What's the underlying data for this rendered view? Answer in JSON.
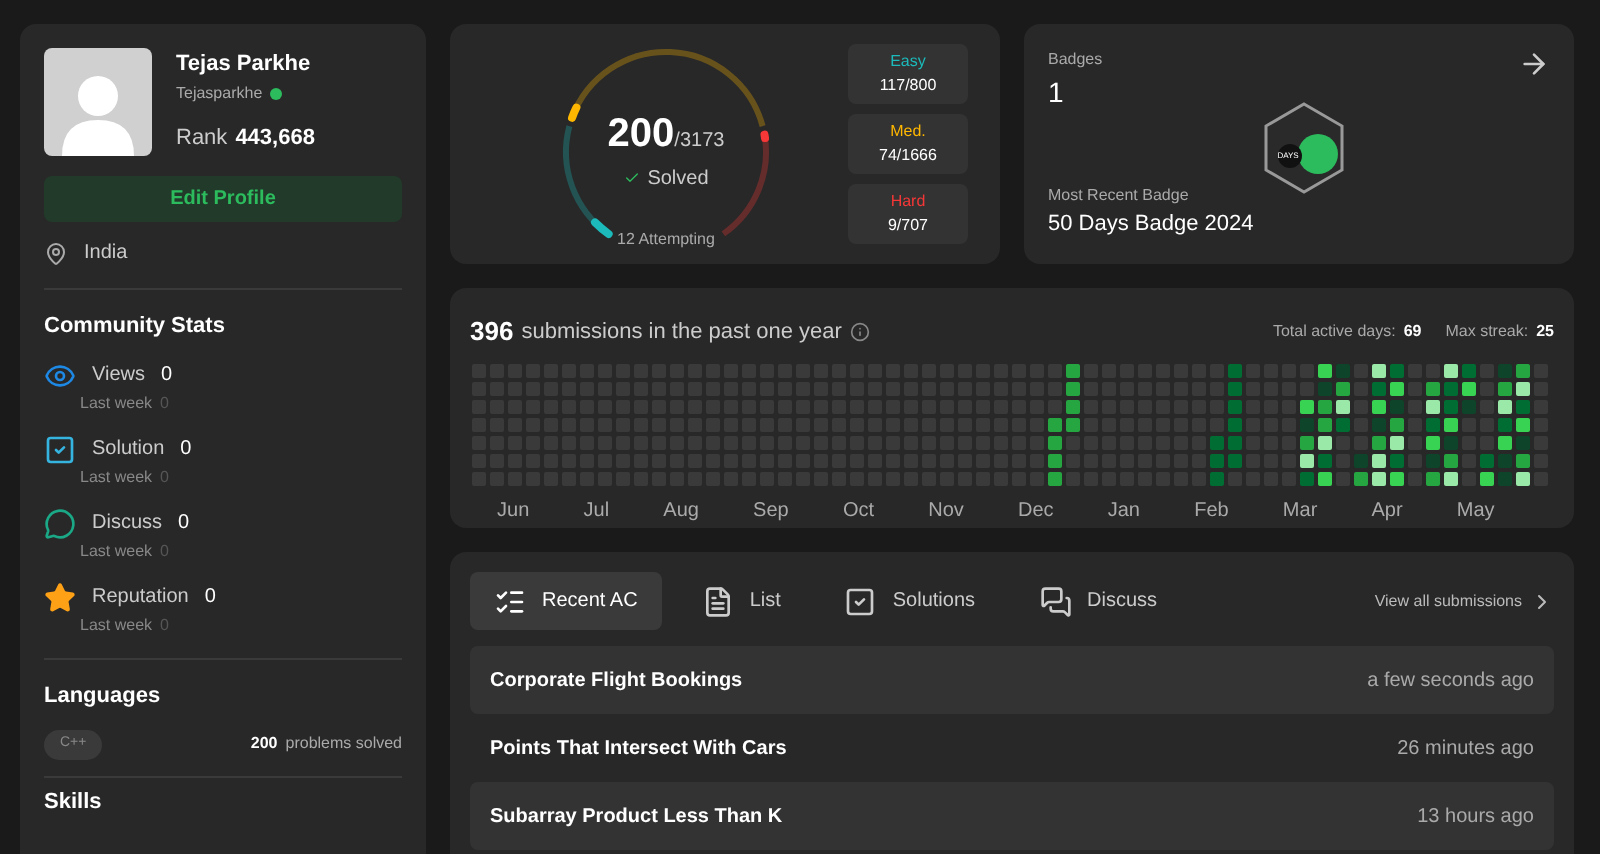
{
  "profile": {
    "name": "Tejas Parkhe",
    "username": "Tejasparkhe",
    "rank_label": "Rank",
    "rank": "443,668",
    "edit_button": "Edit Profile",
    "location": "India"
  },
  "community": {
    "title": "Community Stats",
    "stats": [
      {
        "kind": "views",
        "label": "Views",
        "value": "0",
        "sub_label": "Last week",
        "sub_value": "0"
      },
      {
        "kind": "solution",
        "label": "Solution",
        "value": "0",
        "sub_label": "Last week",
        "sub_value": "0"
      },
      {
        "kind": "discuss",
        "label": "Discuss",
        "value": "0",
        "sub_label": "Last week",
        "sub_value": "0"
      },
      {
        "kind": "reputation",
        "label": "Reputation",
        "value": "0",
        "sub_label": "Last week",
        "sub_value": "0"
      }
    ]
  },
  "languages": {
    "title": "Languages",
    "items": [
      {
        "name": "C++",
        "count": "200",
        "suffix": "problems solved"
      }
    ]
  },
  "skills": {
    "title": "Skills"
  },
  "progress": {
    "solved": "200",
    "total": "/3173",
    "solved_label": "Solved",
    "attempting": "12 Attempting",
    "difficulties": [
      {
        "kind": "easy",
        "label": "Easy",
        "value": "117/800"
      },
      {
        "kind": "medium",
        "label": "Med.",
        "value": "74/1666"
      },
      {
        "kind": "hard",
        "label": "Hard",
        "value": "9/707"
      }
    ],
    "ring": [
      {
        "kind": "easy",
        "level": 0.146
      },
      {
        "kind": "medium",
        "level": 0.044
      },
      {
        "kind": "hard",
        "level": 0.013
      }
    ]
  },
  "badges": {
    "title": "Badges",
    "count": "1",
    "recent_label": "Most Recent Badge",
    "recent": "50 Days Badge 2024",
    "badge_text": "DAYS"
  },
  "calendar": {
    "count": "396",
    "text": "submissions in the past one year",
    "active_label": "Total active days:",
    "active": "69",
    "streak_label": "Max streak:",
    "streak": "25",
    "months": [
      "Jun",
      "Jul",
      "Aug",
      "Sep",
      "Oct",
      "Nov",
      "Dec",
      "Jan",
      "Feb",
      "Mar",
      "Apr",
      "May"
    ]
  },
  "tabs": [
    {
      "kind": "recent",
      "label": "Recent AC",
      "selected": true
    },
    {
      "kind": "list",
      "label": "List",
      "selected": false
    },
    {
      "kind": "solutions",
      "label": "Solutions",
      "selected": false
    },
    {
      "kind": "discuss",
      "label": "Discuss",
      "selected": false
    }
  ],
  "view_all": "View all submissions",
  "submissions": [
    {
      "title": "Corporate Flight Bookings",
      "time": "a few seconds ago"
    },
    {
      "title": "Points That Intersect With Cars",
      "time": "26 minutes ago"
    },
    {
      "title": "Subarray Product Less Than K",
      "time": "13 hours ago"
    }
  ]
}
